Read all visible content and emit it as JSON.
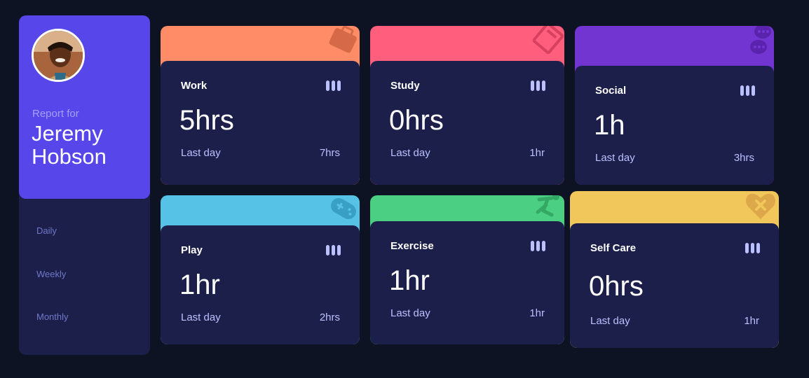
{
  "profile": {
    "report_for": "Report for",
    "name": "Jeremy Hobson",
    "accent": "#5746ea"
  },
  "periods": [
    {
      "label": "Daily"
    },
    {
      "label": "Weekly"
    },
    {
      "label": "Monthly"
    }
  ],
  "cards": [
    {
      "title": "Work",
      "current": "5hrs",
      "previous_label": "Last day",
      "previous": "7hrs",
      "color": "#ff8c66",
      "icon": "briefcase-icon"
    },
    {
      "title": "Study",
      "current": "0hrs",
      "previous_label": "Last day",
      "previous": "1hr",
      "color": "#ff5e7d",
      "icon": "book-icon"
    },
    {
      "title": "Social",
      "current": "1h",
      "previous_label": "Last day",
      "previous": "3hrs",
      "color": "#7335d2",
      "icon": "chat-icon"
    },
    {
      "title": "Play",
      "current": "1hr",
      "previous_label": "Last day",
      "previous": "2hrs",
      "color": "#56c2e6",
      "icon": "gamepad-icon"
    },
    {
      "title": "Exercise",
      "current": "1hr",
      "previous_label": "Last day",
      "previous": "1hr",
      "color": "#4bcf83",
      "icon": "running-icon"
    },
    {
      "title": "Self Care",
      "current": "0hrs",
      "previous_label": "Last day",
      "previous": "1hr",
      "color": "#f1c65b",
      "icon": "heart-icon"
    }
  ]
}
